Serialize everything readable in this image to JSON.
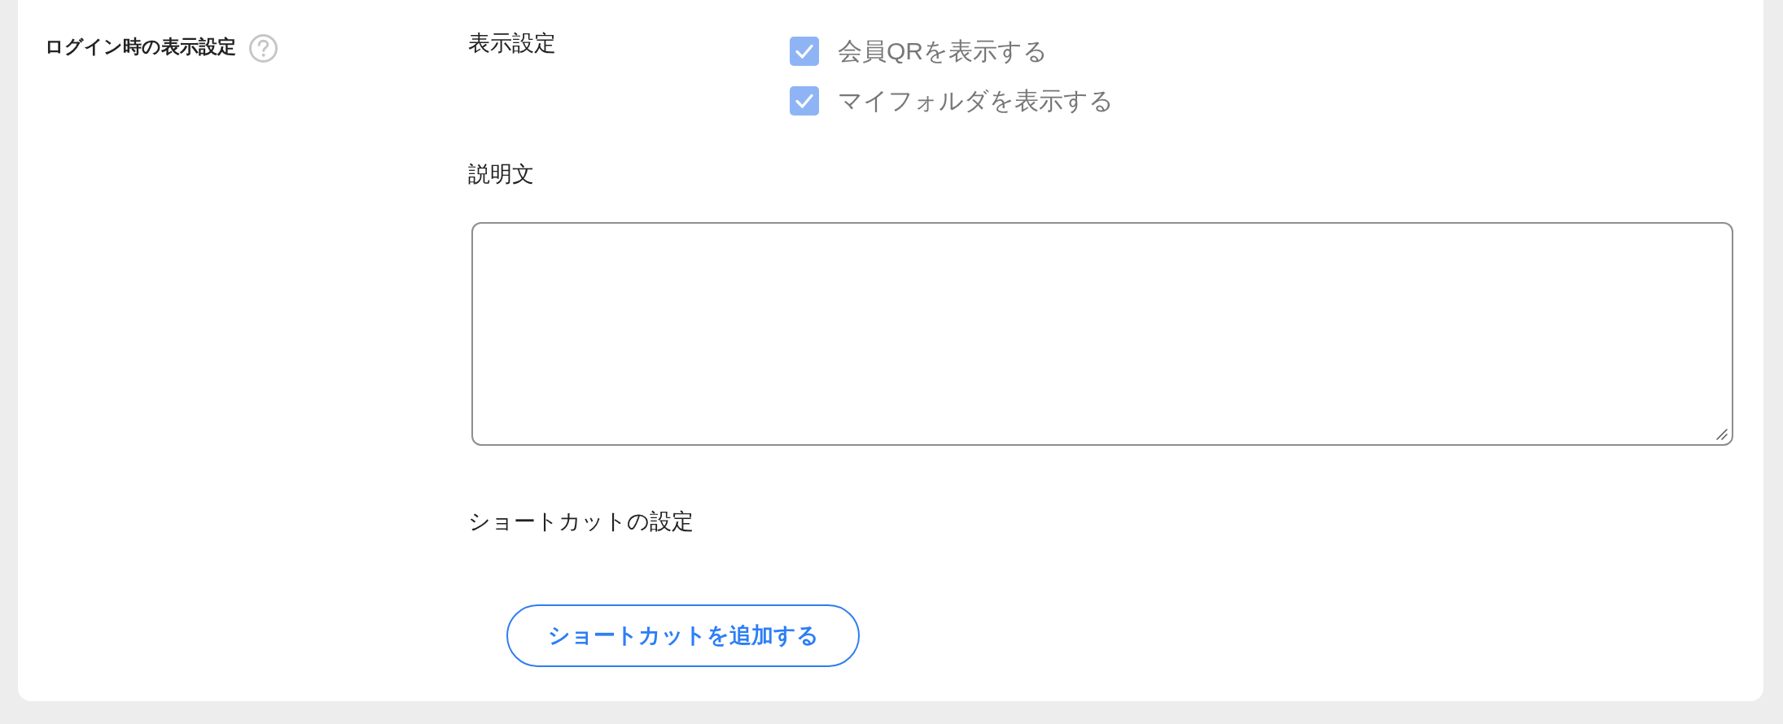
{
  "setting": {
    "title": "ログイン時の表示設定"
  },
  "display_settings": {
    "label": "表示設定",
    "options": [
      {
        "label": "会員QRを表示する",
        "checked": true
      },
      {
        "label": "マイフォルダを表示する",
        "checked": true
      }
    ]
  },
  "description": {
    "label": "説明文"
  },
  "shortcuts": {
    "label": "ショートカットの設定",
    "button": "ショートカットを追加する"
  }
}
